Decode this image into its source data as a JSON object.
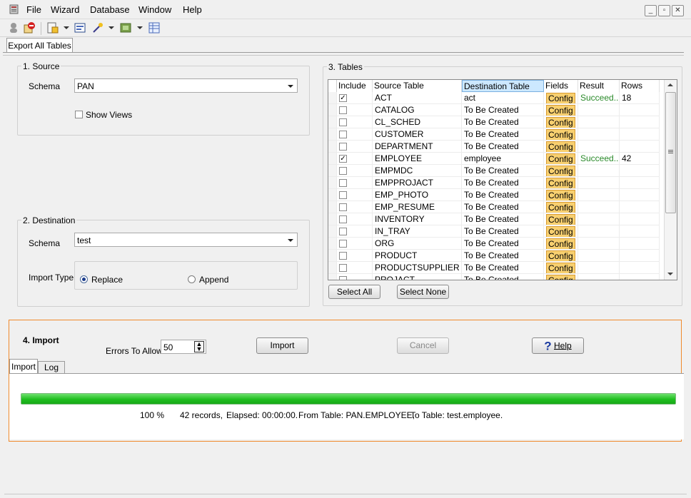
{
  "menu": {
    "items": [
      "File",
      "Wizard",
      "Database",
      "Window",
      "Help"
    ]
  },
  "window_controls": [
    "minimize-icon",
    "restore-icon",
    "close-icon"
  ],
  "toolbar": {
    "icons": [
      "person-icon",
      "stop-icon",
      "edit-icon",
      "preview-icon",
      "magic-wand-icon",
      "window-icon",
      "grid-icon"
    ]
  },
  "main_tab": {
    "label": "Export All Tables"
  },
  "source": {
    "title": "1. Source",
    "schema_label": "Schema",
    "schema_value": "PAN",
    "show_views_label": "Show Views",
    "show_views_checked": false
  },
  "destination": {
    "title": "2. Destination",
    "schema_label": "Schema",
    "schema_value": "test",
    "import_type_label": "Import Type",
    "replace_label": "Replace",
    "append_label": "Append",
    "selected": "Replace"
  },
  "tables": {
    "title": "3. Tables",
    "columns": [
      "Include",
      "Source Table",
      "Destination Table",
      "Fields",
      "Result",
      "Rows"
    ],
    "rows": [
      {
        "include": true,
        "source": "ACT",
        "dest": "act",
        "fields": "Config",
        "result": "Succeed...",
        "rows": "18"
      },
      {
        "include": false,
        "source": "CATALOG",
        "dest": "To Be Created",
        "fields": "Config",
        "result": "",
        "rows": ""
      },
      {
        "include": false,
        "source": "CL_SCHED",
        "dest": "To Be Created",
        "fields": "Config",
        "result": "",
        "rows": ""
      },
      {
        "include": false,
        "source": "CUSTOMER",
        "dest": "To Be Created",
        "fields": "Config",
        "result": "",
        "rows": ""
      },
      {
        "include": false,
        "source": "DEPARTMENT",
        "dest": "To Be Created",
        "fields": "Config",
        "result": "",
        "rows": ""
      },
      {
        "include": true,
        "source": "EMPLOYEE",
        "dest": "employee",
        "fields": "Config",
        "result": "Succeed...",
        "rows": "42"
      },
      {
        "include": false,
        "source": "EMPMDC",
        "dest": "To Be Created",
        "fields": "Config",
        "result": "",
        "rows": ""
      },
      {
        "include": false,
        "source": "EMPPROJACT",
        "dest": "To Be Created",
        "fields": "Config",
        "result": "",
        "rows": ""
      },
      {
        "include": false,
        "source": "EMP_PHOTO",
        "dest": "To Be Created",
        "fields": "Config",
        "result": "",
        "rows": ""
      },
      {
        "include": false,
        "source": "EMP_RESUME",
        "dest": "To Be Created",
        "fields": "Config",
        "result": "",
        "rows": ""
      },
      {
        "include": false,
        "source": "INVENTORY",
        "dest": "To Be Created",
        "fields": "Config",
        "result": "",
        "rows": ""
      },
      {
        "include": false,
        "source": "IN_TRAY",
        "dest": "To Be Created",
        "fields": "Config",
        "result": "",
        "rows": ""
      },
      {
        "include": false,
        "source": "ORG",
        "dest": "To Be Created",
        "fields": "Config",
        "result": "",
        "rows": ""
      },
      {
        "include": false,
        "source": "PRODUCT",
        "dest": "To Be Created",
        "fields": "Config",
        "result": "",
        "rows": ""
      },
      {
        "include": false,
        "source": "PRODUCTSUPPLIER",
        "dest": "To Be Created",
        "fields": "Config",
        "result": "",
        "rows": ""
      },
      {
        "include": false,
        "source": "PROJACT",
        "dest": "To Be Created",
        "fields": "Config",
        "result": "",
        "rows": ""
      }
    ],
    "select_all_label": "Select All",
    "select_none_label": "Select None"
  },
  "import": {
    "title": "4. Import",
    "errors_label": "Errors To Allow",
    "errors_value": "50",
    "import_button": "Import",
    "cancel_button": "Cancel",
    "help_button": "Help",
    "tabs": [
      "Import",
      "Log"
    ],
    "progress_percent": 100,
    "status": {
      "percent": "100 %",
      "records": "42 records,",
      "elapsed": "Elapsed: 00:00:00.",
      "from": "From Table: PAN.EMPLOYEE,",
      "to": "To Table: test.employee."
    }
  },
  "colors": {
    "accent_orange": "#f08a2c",
    "progress_green": "#1fbf1f",
    "config_bg": "#f8d070",
    "success_text": "#2a8a2a"
  }
}
